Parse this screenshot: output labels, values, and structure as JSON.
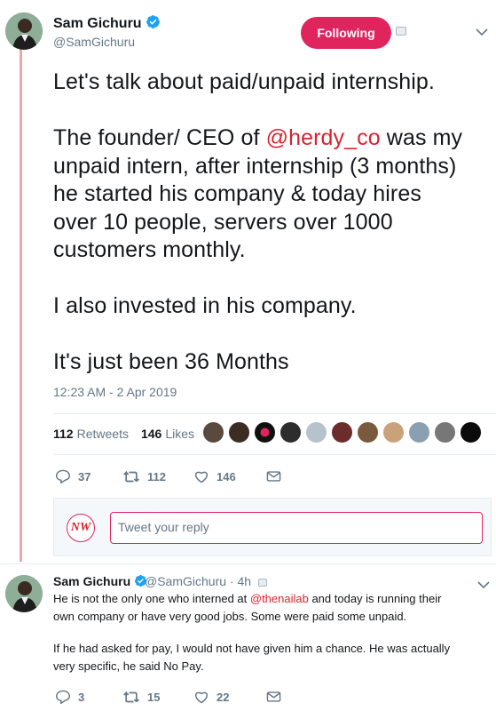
{
  "main_tweet": {
    "author_name": "Sam Gichuru",
    "author_handle": "@SamGichuru",
    "follow_label": "Following",
    "lines": [
      "Let's talk about paid/unpaid internship.",
      "",
      "The founder/ CEO of ",
      "unpaid intern, after internship (3 months)",
      "he started his company & today hires",
      "over 10 people, servers over 1000",
      "customers monthly.",
      "",
      "I also invested in his company.",
      "",
      "It's just been 36 Months"
    ],
    "mention": "@herdy_co",
    "after_mention": " was my",
    "timestamp": "12:23 AM - 2 Apr 2019",
    "retweets_count": "112",
    "retweets_label": "Retweets",
    "likes_count": "146",
    "likes_label": "Likes",
    "reply_count": "37",
    "retweet_action_count": "112",
    "like_action_count": "146"
  },
  "reply_box": {
    "logo_text": "NW",
    "placeholder": "Tweet your reply"
  },
  "reply_tweet": {
    "author_name": "Sam Gichuru",
    "author_handle": "@SamGichuru",
    "time": "· 4h",
    "line1_pre": "He is not the only one who interned at ",
    "line1_mention": "@thenailab",
    "line1_post": " and today is running their",
    "line2": "own company or have very good jobs. Some were paid some unpaid.",
    "line3": "If he had asked for pay, I would not have given him a chance. He was actually",
    "line4": "very specific, he said No Pay.",
    "reply_count": "3",
    "retweet_count": "15",
    "like_count": "22"
  },
  "colors": {
    "accent": "#e0245e",
    "mention": "#d9232e",
    "muted": "#657786",
    "verified": "#1da1f2",
    "thread_line": "#e7a7ab"
  }
}
